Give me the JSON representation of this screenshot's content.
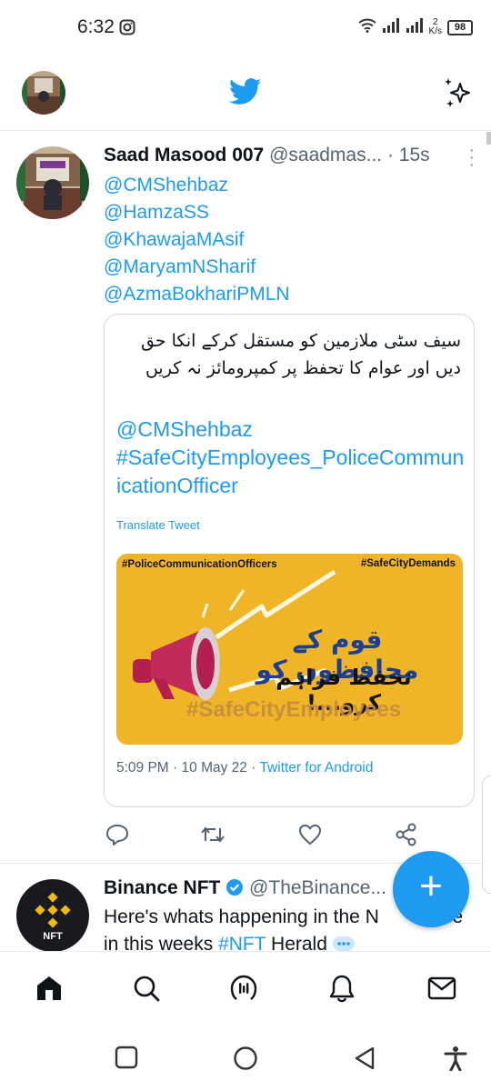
{
  "status_bar": {
    "time": "6:32",
    "net_speed_value": "2",
    "net_speed_unit": "K/s",
    "battery": "98",
    "icons": [
      "instagram-icon",
      "wifi-icon",
      "signal-icon",
      "signal-icon",
      "battery-icon"
    ]
  },
  "header": {
    "logo": "twitter-bird-icon",
    "right_icon": "sparkle-icon"
  },
  "tweet1": {
    "name": "Saad Masood 007",
    "handle": "@saadmas...",
    "dot": "·",
    "time": "15s",
    "mentions": [
      "@CMShehbaz",
      "@HamzaSS",
      "@KhawajaMAsif",
      "@MaryamNSharif",
      "@AzmaBokhariPMLN"
    ],
    "quoted": {
      "urdu_text": "سیف سٹی ملازمین کو مستقل کرکے انکا حق دیں اور عوام کا تحفظ پر کمپرومائز نہ کریں",
      "mention": "@CMShehbaz",
      "hashtag": "#SafeCityEmployees_PoliceCommunicationOfficer",
      "translate_label": "Translate Tweet",
      "poster": {
        "tag_left": "#PoliceCommunicationOfficers",
        "tag_right": "#SafeCityDemands",
        "urdu_line1": "قوم کے محافظوں کو",
        "urdu_line2": "تحفظ فراہم کرو...!",
        "hashtag": "#SafeCityEmployees"
      },
      "meta_time": "5:09 PM",
      "meta_sep": "·",
      "meta_date": "10 May 22",
      "meta_source": "Twitter for Android"
    }
  },
  "tweet2": {
    "name": "Binance NFT",
    "handle": "@TheBinance...",
    "body_start": "Here's whats happening in the N",
    "body_end": "se",
    "body_line2_start": "in this weeks ",
    "hashtag": "#NFT",
    "body_line2_end": " Herald",
    "avatar_label": "NFT"
  },
  "fab": {
    "label": "+"
  },
  "bottom_nav": [
    "home-icon",
    "search-icon",
    "spaces-icon",
    "notifications-icon",
    "messages-icon"
  ],
  "system_nav": [
    "recents-button",
    "home-button",
    "back-button",
    "accessibility-button"
  ]
}
